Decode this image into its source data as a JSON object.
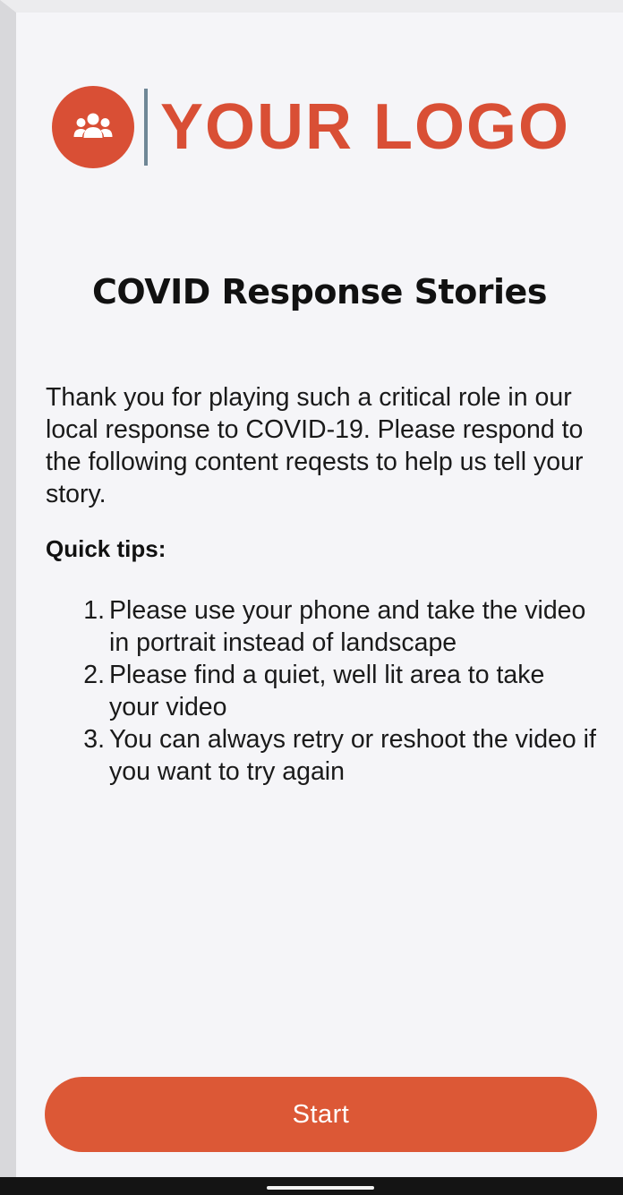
{
  "logo": {
    "icon": "group-people-icon",
    "text": "YOUR LOGO",
    "color": "#d94f35",
    "divider_color": "#6f8796"
  },
  "page": {
    "title": "COVID Response Stories",
    "intro": "Thank you for playing such a critical role in our local response to COVID-19. Please respond to the following content reqests to help us tell your story."
  },
  "tips": {
    "heading": "Quick tips:",
    "items": [
      {
        "number": "1.",
        "text": "Please use your phone and take the video in portrait instead of landscape"
      },
      {
        "number": "2.",
        "text": "Please find a quiet, well lit area to take your video"
      },
      {
        "number": "3.",
        "text": "You can always retry or reshoot the video if you want to try again"
      }
    ]
  },
  "actions": {
    "start_label": "Start",
    "button_color": "#dc5836"
  },
  "colors": {
    "background": "#f5f5f8",
    "text": "#1a1a1a",
    "nav_bar": "#141414"
  }
}
